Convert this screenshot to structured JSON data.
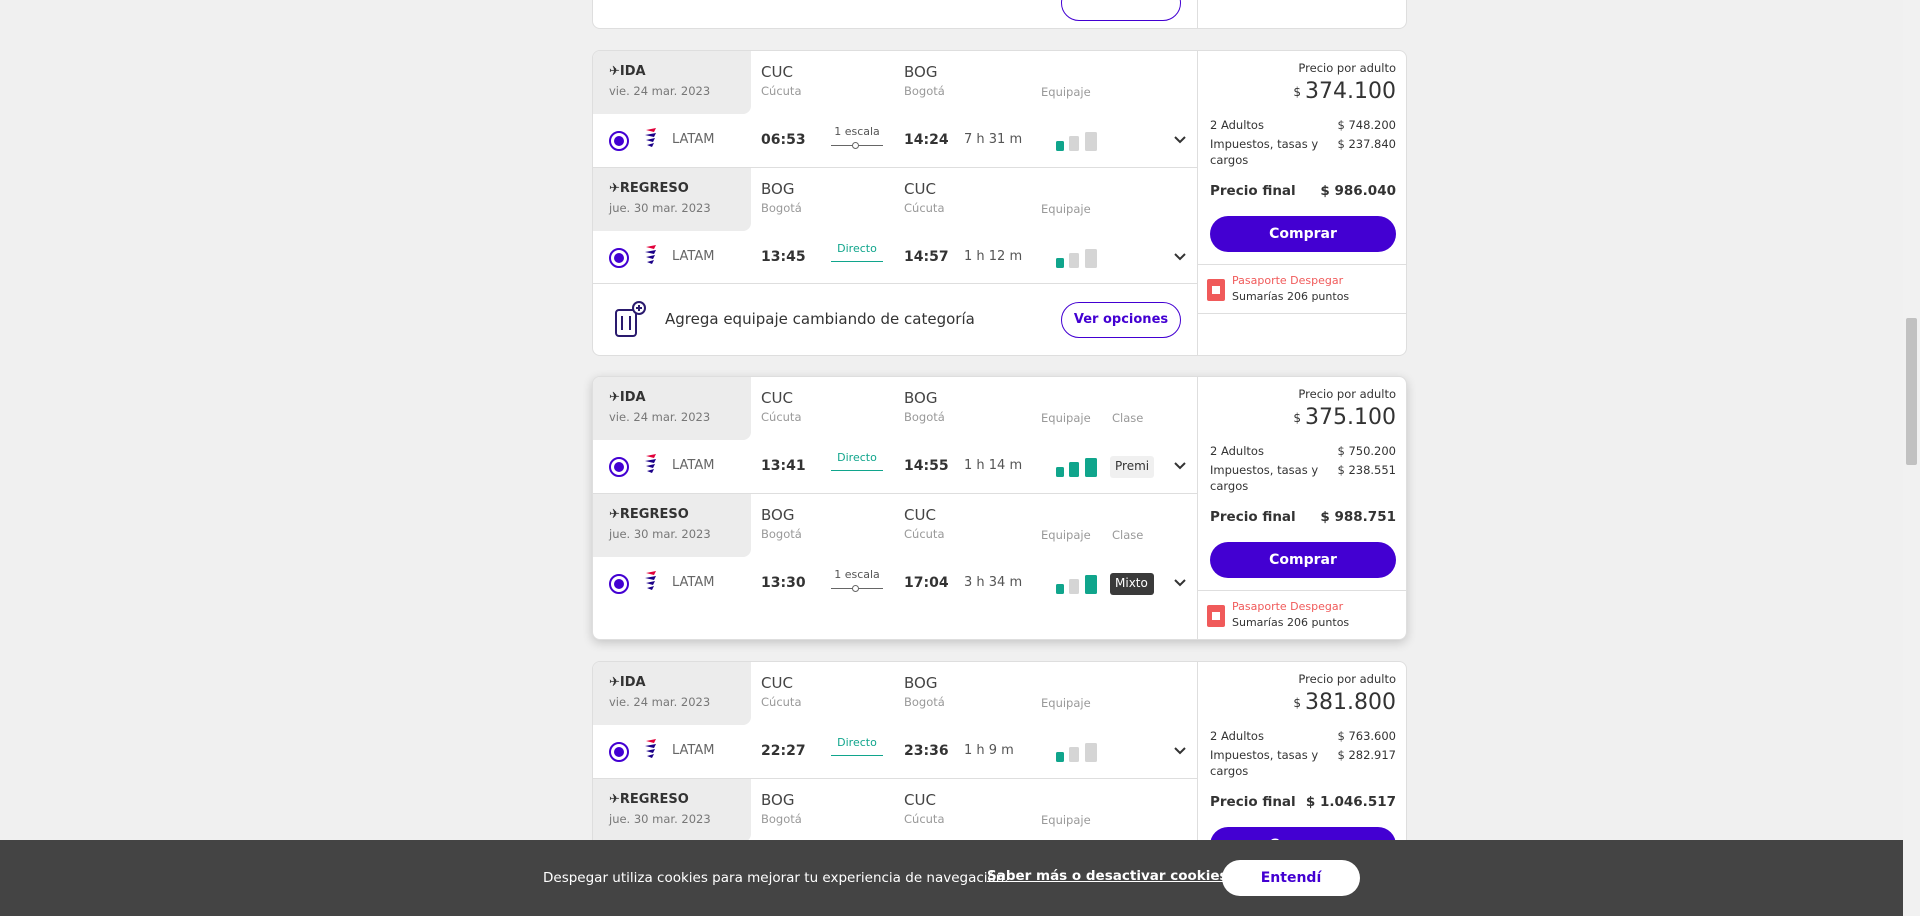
{
  "colors": {
    "accent": "#4300d2",
    "direct": "#10a58c",
    "pasaporte": "#f05a5a"
  },
  "labels": {
    "ida": "IDA",
    "regreso": "REGRESO",
    "equipaje": "Equipaje",
    "clase": "Clase",
    "precio_por_adulto": "Precio por adulto",
    "adultos": "2 Adultos",
    "impuestos": "Impuestos, tasas y cargos",
    "precio_final": "Precio final",
    "comprar": "Comprar",
    "pasaporte": "Pasaporte Despegar",
    "currency": "$"
  },
  "add_baggage": {
    "text": "Agrega equipaje cambiando de categoría",
    "button": "Ver opciones"
  },
  "cards": [
    {
      "legs": [
        {
          "date": "vie. 24 mar. 2023",
          "from_code": "CUC",
          "from_city": "Cúcuta",
          "to_code": "BOG",
          "to_city": "Bogotá",
          "airline": "LATAM",
          "dep": "06:53",
          "stops": "1 escala",
          "arr": "14:24",
          "duration": "7 h 31 m",
          "baggage_icons": [
            "bag",
            "suitcase-gray",
            "suitcase-gray"
          ]
        },
        {
          "date": "jue. 30 mar. 2023",
          "from_code": "BOG",
          "from_city": "Bogotá",
          "to_code": "CUC",
          "to_city": "Cúcuta",
          "airline": "LATAM",
          "dep": "13:45",
          "stops": "Directo",
          "arr": "14:57",
          "duration": "1 h 12 m",
          "baggage_icons": [
            "bag",
            "suitcase-gray",
            "suitcase-gray"
          ]
        }
      ],
      "price_per_adult": "374.100",
      "adults_total": "$ 748.200",
      "taxes": "$ 237.840",
      "final_price": "$ 986.040",
      "points": "Sumarías 206 puntos"
    },
    {
      "legs": [
        {
          "date": "vie. 24 mar. 2023",
          "from_code": "CUC",
          "from_city": "Cúcuta",
          "to_code": "BOG",
          "to_city": "Bogotá",
          "airline": "LATAM",
          "dep": "13:41",
          "stops": "Directo",
          "arr": "14:55",
          "duration": "1 h 14 m",
          "class": "Premi",
          "baggage_icons": [
            "bag",
            "suitcase-green",
            "suitcase-green"
          ]
        },
        {
          "date": "jue. 30 mar. 2023",
          "from_code": "BOG",
          "from_city": "Bogotá",
          "to_code": "CUC",
          "to_city": "Cúcuta",
          "airline": "LATAM",
          "dep": "13:30",
          "stops": "1 escala",
          "arr": "17:04",
          "duration": "3 h 34 m",
          "class": "Mixto",
          "baggage_icons": [
            "bag",
            "suitcase-gray",
            "suitcase-green"
          ]
        }
      ],
      "price_per_adult": "375.100",
      "adults_total": "$ 750.200",
      "taxes": "$ 238.551",
      "final_price": "$ 988.751",
      "points": "Sumarías 206 puntos"
    },
    {
      "legs": [
        {
          "date": "vie. 24 mar. 2023",
          "from_code": "CUC",
          "from_city": "Cúcuta",
          "to_code": "BOG",
          "to_city": "Bogotá",
          "airline": "LATAM",
          "dep": "22:27",
          "stops": "Directo",
          "arr": "23:36",
          "duration": "1 h 9 m",
          "baggage_icons": [
            "bag",
            "suitcase-gray",
            "suitcase-gray"
          ]
        },
        {
          "date": "jue. 30 mar. 2023",
          "from_code": "BOG",
          "from_city": "Bogotá",
          "to_code": "CUC",
          "to_city": "Cúcuta"
        }
      ],
      "price_per_adult": "381.800",
      "adults_total": "$ 763.600",
      "taxes": "$ 282.917",
      "final_price": "$ 1.046.517"
    }
  ],
  "cookie": {
    "message": "Despegar utiliza cookies para mejorar tu experiencia de navegación.",
    "link": "Saber más o desactivar cookies.",
    "button": "Entendí"
  }
}
